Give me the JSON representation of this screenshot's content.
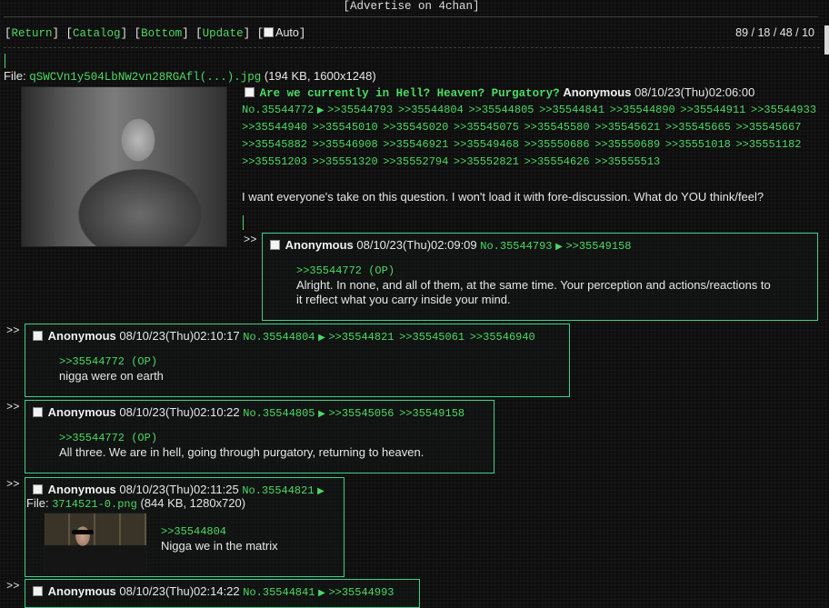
{
  "ad_text": "[Advertise on 4chan]",
  "nav": {
    "return": "Return",
    "catalog": "Catalog",
    "bottom": "Bottom",
    "update": "Update",
    "auto": "Auto"
  },
  "stats": "89 / 18 / 48 / 10",
  "op": {
    "file_label": "File:",
    "file_name": "qSWCVn1y504LbNW2vn28RGAfl(...).jpg",
    "file_meta": "(194 KB, 1600x1248)",
    "subject": "Are we currently in Hell? Heaven? Purgatory?",
    "name": "Anonymous",
    "datetime": "08/10/23(Thu)02:06:00",
    "post_no": "No.35544772",
    "backlinks": [
      ">>35544793",
      ">>35544804",
      ">>35544805",
      ">>35544841",
      ">>35544890",
      ">>35544911",
      ">>35544933",
      ">>35544940",
      ">>35545010",
      ">>35545020",
      ">>35545075",
      ">>35545580",
      ">>35545621",
      ">>35545665",
      ">>35545667",
      ">>35545882",
      ">>35546908",
      ">>35546921",
      ">>35549468",
      ">>35550686",
      ">>35550689",
      ">>35551018",
      ">>35551182",
      ">>35551203",
      ">>35551320",
      ">>35552794",
      ">>35552821",
      ">>35554626",
      ">>35555513"
    ],
    "body": "I want everyone's take on this question. I won't load it with fore-discussion. What do YOU think/feel?"
  },
  "arrow_glyph": "▶",
  "reply_marker": ">>",
  "replies": [
    {
      "name": "Anonymous",
      "datetime": "08/10/23(Thu)02:09:09",
      "post_no": "No.35544793",
      "backlinks": [
        ">>35549158"
      ],
      "quote": ">>35544772 (OP)",
      "text_lines": [
        "Alright. In none, and all of them, at the same time. Your perception and actions/reactions to",
        "it reflect what you carry inside your mind."
      ]
    },
    {
      "name": "Anonymous",
      "datetime": "08/10/23(Thu)02:10:17",
      "post_no": "No.35544804",
      "backlinks": [
        ">>35544821",
        ">>35545061",
        ">>35546940"
      ],
      "quote": ">>35544772 (OP)",
      "text_lines": [
        "nigga were on earth"
      ]
    },
    {
      "name": "Anonymous",
      "datetime": "08/10/23(Thu)02:10:22",
      "post_no": "No.35544805",
      "backlinks": [
        ">>35545056",
        ">>35549158"
      ],
      "quote": ">>35544772 (OP)",
      "text_lines": [
        "All three. We are in hell, going through purgatory, returning to heaven."
      ]
    },
    {
      "name": "Anonymous",
      "datetime": "08/10/23(Thu)02:11:25",
      "post_no": "No.35544821",
      "backlinks": [],
      "file_label": "File:",
      "file_name": "3714521-0.png",
      "file_meta": "(844 KB, 1280x720)",
      "quote": ">>35544804",
      "text_lines": [
        "Nigga we in the matrix"
      ]
    },
    {
      "name": "Anonymous",
      "datetime": "08/10/23(Thu)02:14:22",
      "post_no": "No.35544841",
      "backlinks": [
        ">>35544993"
      ],
      "quote": "",
      "text_lines": []
    }
  ]
}
